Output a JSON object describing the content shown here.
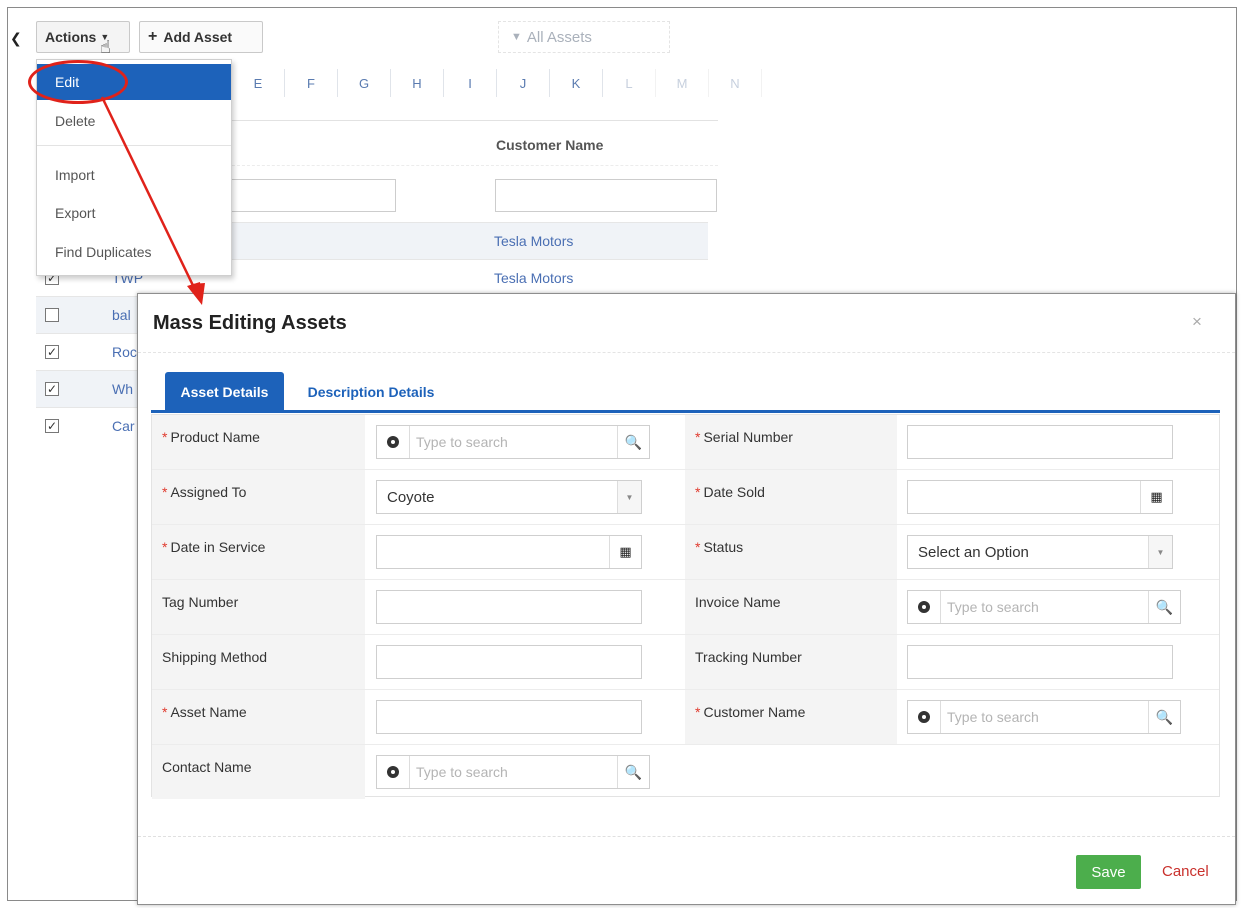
{
  "toolbar": {
    "back_icon": "chevron-left-icon",
    "actions_label": "Actions",
    "add_asset_label": "Add Asset",
    "filter_label": "All Assets"
  },
  "alphabet": [
    "E",
    "F",
    "G",
    "H",
    "I",
    "J",
    "K",
    "L",
    "M",
    "N"
  ],
  "actions_menu": {
    "items": [
      "Edit",
      "Delete",
      "Import",
      "Export",
      "Find Duplicates"
    ],
    "active": "Edit"
  },
  "list": {
    "column_header": "Customer Name",
    "rows": [
      {
        "name": "",
        "customer": "Tesla Motors",
        "checked": false
      },
      {
        "name": "TWP",
        "customer": "Tesla Motors",
        "checked": true
      },
      {
        "name": "bal",
        "customer": "",
        "checked": false
      },
      {
        "name": "Roc",
        "customer": "",
        "checked": true
      },
      {
        "name": "Wh",
        "customer": "",
        "checked": true
      },
      {
        "name": "Car",
        "customer": "",
        "checked": true
      }
    ]
  },
  "modal": {
    "title": "Mass Editing Assets",
    "close_icon": "×",
    "tabs": [
      "Asset Details",
      "Description Details"
    ],
    "search_placeholder": "Type to search",
    "fields": {
      "product_name": "Product Name",
      "serial_number": "Serial Number",
      "assigned_to": "Assigned To",
      "assigned_to_value": "Coyote",
      "date_sold": "Date Sold",
      "date_in_service": "Date in Service",
      "status": "Status",
      "status_value": "Select an Option",
      "tag_number": "Tag Number",
      "invoice_name": "Invoice Name",
      "shipping_method": "Shipping Method",
      "tracking_number": "Tracking Number",
      "asset_name": "Asset Name",
      "customer_name": "Customer Name",
      "contact_name": "Contact Name"
    },
    "save_label": "Save",
    "cancel_label": "Cancel"
  },
  "colors": {
    "accent": "#1d62ba",
    "save": "#4cae4c",
    "cancel": "#c9302c",
    "annotation": "#e0221a"
  }
}
